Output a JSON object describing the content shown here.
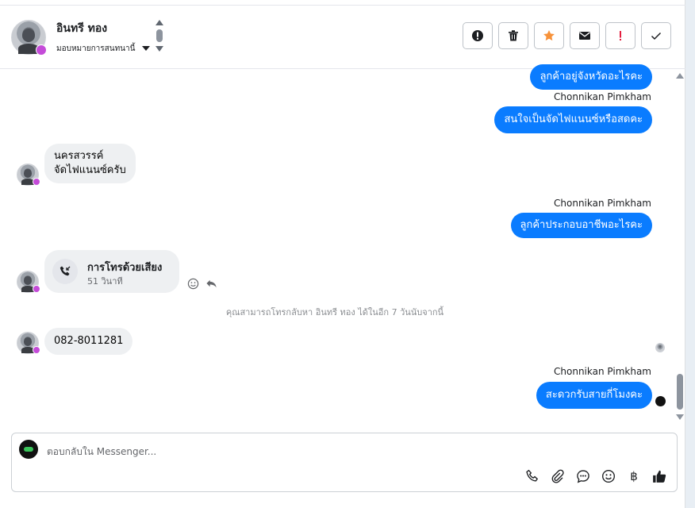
{
  "header": {
    "contact_name": "อินทรี ทอง",
    "assign_label": "มอบหมายการสนทนานี้"
  },
  "toolbar": {
    "buttons": [
      "alert-circle-icon",
      "trash-icon",
      "star-icon",
      "mail-icon",
      "exclamation-icon",
      "check-icon"
    ]
  },
  "messages": {
    "m1_text": "ลูกค้าอยู่จังหวัดอะไรคะ",
    "m2_sender": "Chonnikan Pimkham",
    "m2_text": "สนใจเป็นจัดไฟแนนซ์หรือสดคะ",
    "m3_line1": "นครสวรรค์",
    "m3_line2": "จัดไฟแนนซ์ครับ",
    "m4_sender": "Chonnikan Pimkham",
    "m4_text": "ลูกค้าประกอบอาชีพอะไรคะ",
    "call_title": "การโทรด้วยเสียง",
    "call_duration": "51 วินาที",
    "notice": "คุณสามารถโทรกลับหา อินทรี ทอง ได้ในอีก 7 วันนับจากนี้",
    "m5_text": "082-8011281",
    "m6_sender": "Chonnikan Pimkham",
    "m6_text": "สะดวกรับสายกี่โมงคะ"
  },
  "composer": {
    "placeholder": "ตอบกลับใน Messenger..."
  },
  "colors": {
    "outgoing_bubble": "#0a7cff",
    "incoming_bubble": "#eef0f2",
    "star": "#f7923a",
    "alert": "#e41e3f"
  }
}
